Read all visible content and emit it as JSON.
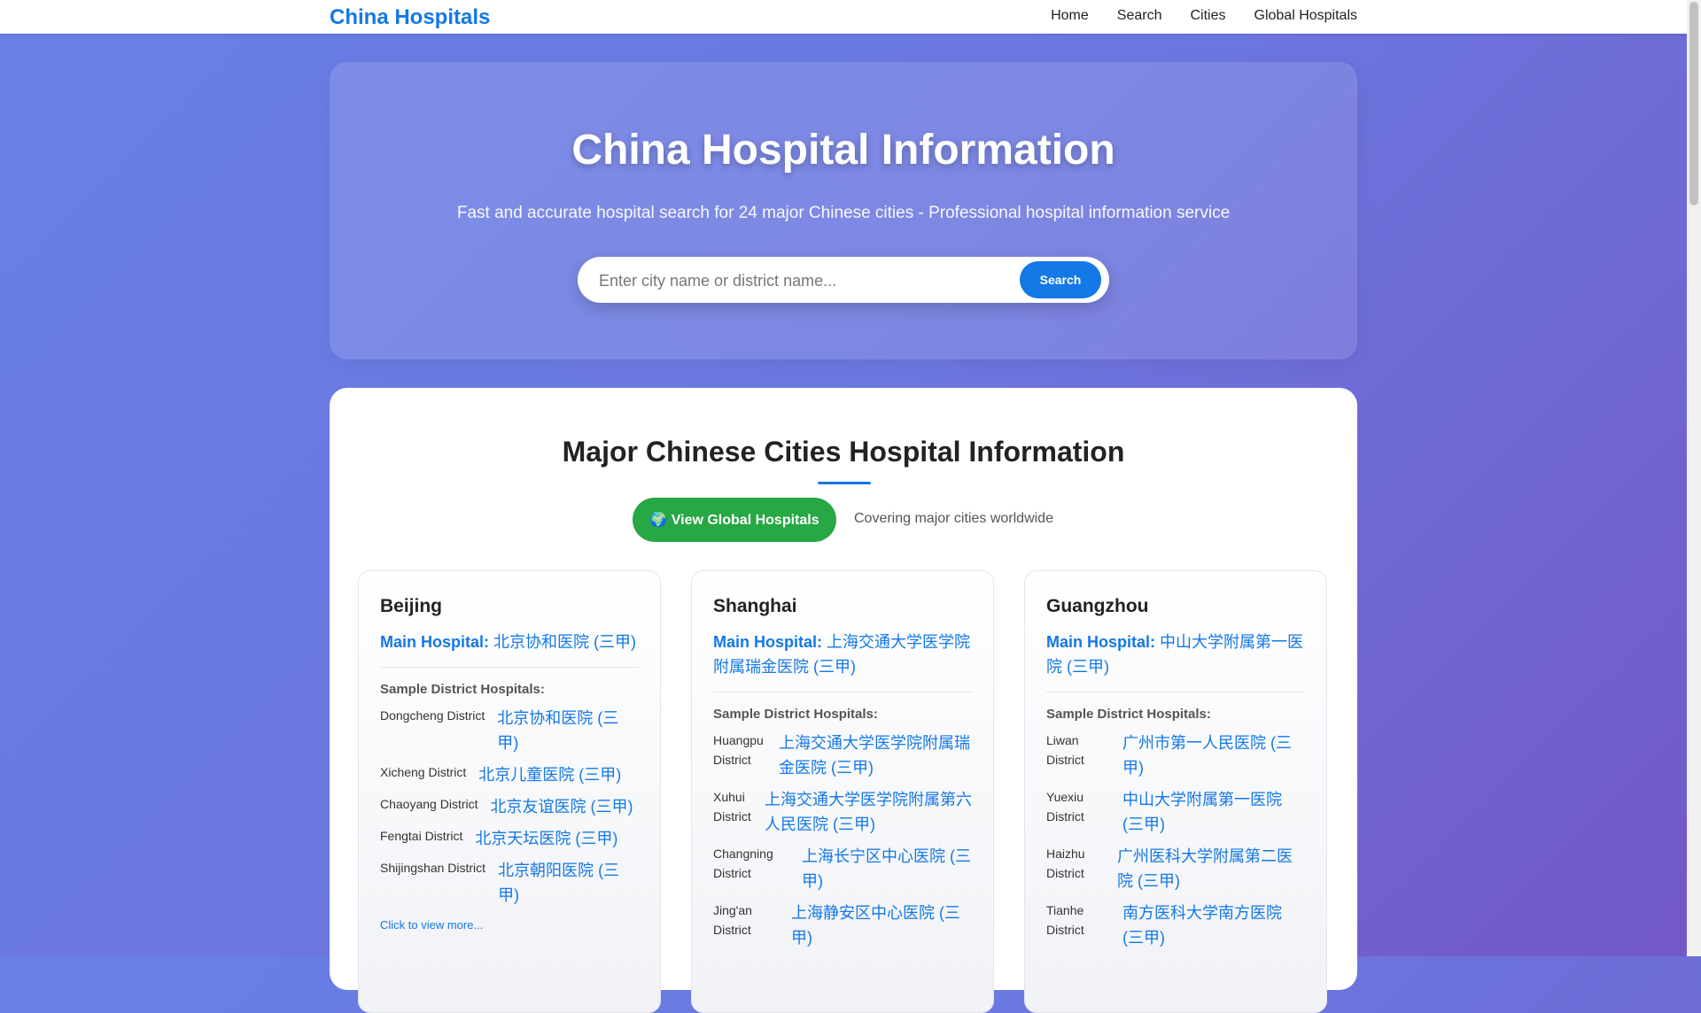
{
  "nav": {
    "brand": "China Hospitals",
    "links": [
      "Home",
      "Search",
      "Cities",
      "Global Hospitals"
    ]
  },
  "hero": {
    "title": "China Hospital Information",
    "subtitle": "Fast and accurate hospital search for 24 major Chinese cities - Professional hospital information service",
    "search_placeholder": "Enter city name or district name...",
    "search_button": "Search"
  },
  "section": {
    "title": "Major Chinese Cities Hospital Information",
    "global_button": "🌍 View Global Hospitals",
    "global_note": "Covering major cities worldwide"
  },
  "labels": {
    "main_hospital": "Main Hospital:",
    "sample_title": "Sample District Hospitals:",
    "view_more": "Click to view more..."
  },
  "cities": [
    {
      "name": "Beijing",
      "main": "北京协和医院 (三甲)",
      "districts": [
        {
          "name": "Dongcheng District",
          "hospital": "北京协和医院 (三甲)"
        },
        {
          "name": "Xicheng District",
          "hospital": "北京儿童医院 (三甲)"
        },
        {
          "name": "Chaoyang District",
          "hospital": "北京友谊医院 (三甲)"
        },
        {
          "name": "Fengtai District",
          "hospital": "北京天坛医院 (三甲)"
        },
        {
          "name": "Shijingshan District",
          "hospital": "北京朝阳医院 (三甲)"
        }
      ]
    },
    {
      "name": "Shanghai",
      "main": "上海交通大学医学院附属瑞金医院 (三甲)",
      "districts": [
        {
          "name": "Huangpu District",
          "hospital": "上海交通大学医学院附属瑞金医院 (三甲)"
        },
        {
          "name": "Xuhui District",
          "hospital": "上海交通大学医学院附属第六人民医院 (三甲)"
        },
        {
          "name": "Changning District",
          "hospital": "上海长宁区中心医院 (三甲)"
        },
        {
          "name": "Jing'an District",
          "hospital": "上海静安区中心医院 (三甲)"
        }
      ]
    },
    {
      "name": "Guangzhou",
      "main": "中山大学附属第一医院 (三甲)",
      "districts": [
        {
          "name": "Liwan District",
          "hospital": "广州市第一人民医院 (三甲)"
        },
        {
          "name": "Yuexiu District",
          "hospital": "中山大学附属第一医院 (三甲)"
        },
        {
          "name": "Haizhu District",
          "hospital": "广州医科大学附属第二医院 (三甲)"
        },
        {
          "name": "Tianhe District",
          "hospital": "南方医科大学南方医院 (三甲)"
        }
      ]
    }
  ]
}
